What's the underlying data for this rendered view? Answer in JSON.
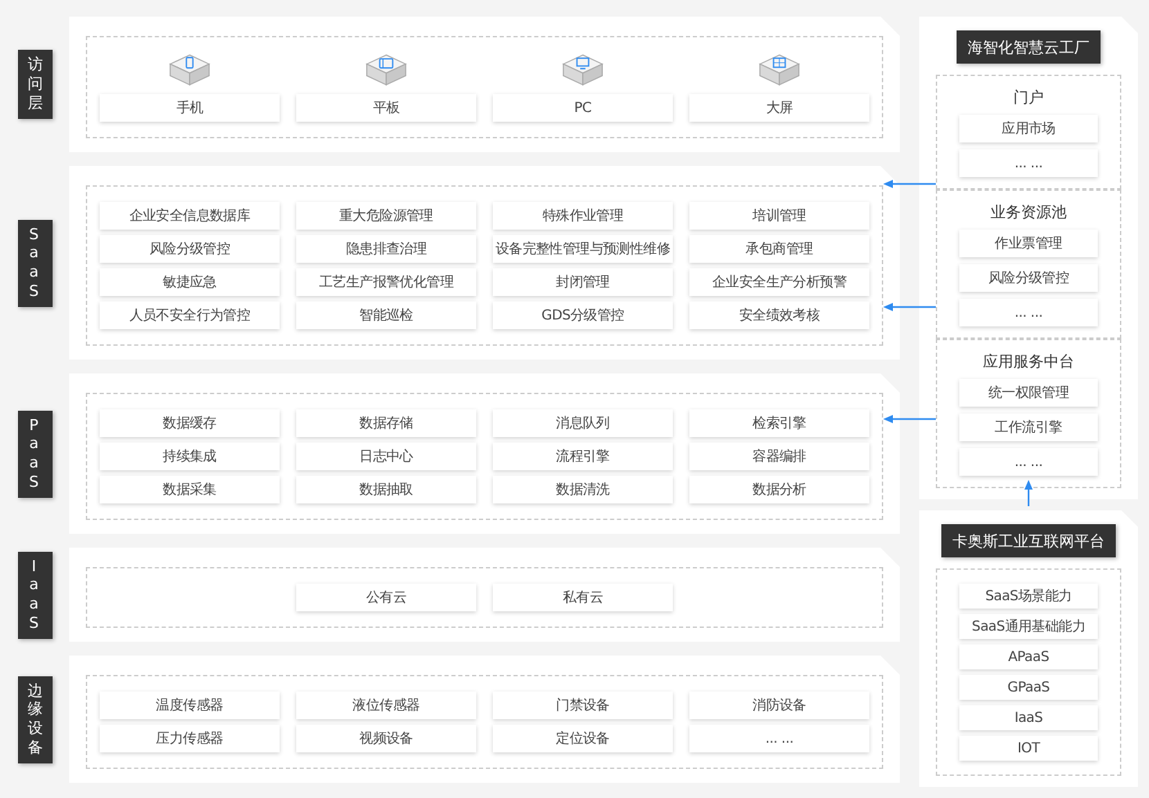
{
  "layers": [
    {
      "label": "访问层",
      "kind": "devices",
      "items": [
        {
          "kind": "phone",
          "label": "手机"
        },
        {
          "kind": "tablet",
          "label": "平板"
        },
        {
          "kind": "pc",
          "label": "PC"
        },
        {
          "kind": "screen",
          "label": "大屏"
        }
      ]
    },
    {
      "label": "SaaS",
      "kind": "modules",
      "items": [
        {
          "label": "企业安全信息数据库"
        },
        {
          "label": "重大危险源管理"
        },
        {
          "label": "特殊作业管理"
        },
        {
          "label": "培训管理"
        },
        {
          "label": "风险分级管控"
        },
        {
          "label": "隐患排查治理"
        },
        {
          "label": "设备完整性管理与预测性维修"
        },
        {
          "label": "承包商管理"
        },
        {
          "label": "敏捷应急"
        },
        {
          "label": "工艺生产报警优化管理"
        },
        {
          "label": "封闭管理"
        },
        {
          "label": "企业安全生产分析预警"
        },
        {
          "label": "人员不安全行为管控"
        },
        {
          "label": "智能巡检"
        },
        {
          "label": "GDS分级管控"
        },
        {
          "label": "安全绩效考核"
        }
      ]
    },
    {
      "label": "PaaS",
      "kind": "modules",
      "items": [
        {
          "label": "数据缓存"
        },
        {
          "label": "数据存储"
        },
        {
          "label": "消息队列"
        },
        {
          "label": "检索引擎"
        },
        {
          "label": "持续集成"
        },
        {
          "label": "日志中心"
        },
        {
          "label": "流程引擎"
        },
        {
          "label": "容器编排"
        },
        {
          "label": "数据采集"
        },
        {
          "label": "数据抽取"
        },
        {
          "label": "数据清洗"
        },
        {
          "label": "数据分析"
        }
      ]
    },
    {
      "label": "IaaS",
      "kind": "modules",
      "items": [
        {
          "label": "公有云"
        },
        {
          "label": "私有云"
        }
      ]
    },
    {
      "label": "边缘设备",
      "kind": "modules",
      "items": [
        {
          "label": "温度传感器"
        },
        {
          "label": "液位传感器"
        },
        {
          "label": "门禁设备"
        },
        {
          "label": "消防设备"
        },
        {
          "label": "压力传感器"
        },
        {
          "label": "视频设备"
        },
        {
          "label": "定位设备"
        },
        {
          "label": "... ..."
        }
      ]
    }
  ],
  "platform": {
    "title": "海智化智慧云工厂",
    "groups": [
      {
        "title": "门户",
        "items": [
          "应用市场",
          "... ..."
        ]
      },
      {
        "title": "业务资源池",
        "items": [
          "作业票管理",
          "风险分级管控",
          "... ..."
        ]
      },
      {
        "title": "应用服务中台",
        "items": [
          "统一权限管理",
          "工作流引擎",
          "... ..."
        ]
      }
    ]
  },
  "foundation": {
    "title": "卡奥斯工业互联网平台",
    "items": [
      "SaaS场景能力",
      "SaaS通用基础能力",
      "APaaS",
      "GPaaS",
      "IaaS",
      "IOT"
    ]
  }
}
